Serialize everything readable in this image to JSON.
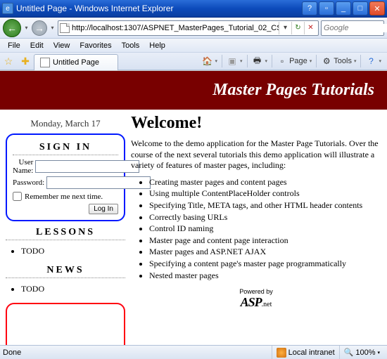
{
  "window": {
    "title": "Untitled Page - Windows Internet Explorer"
  },
  "address": {
    "url": "http://localhost:1307/ASPNET_MasterPages_Tutorial_02_CS/"
  },
  "search": {
    "placeholder": "Google"
  },
  "menu": {
    "file": "File",
    "edit": "Edit",
    "view": "View",
    "favorites": "Favorites",
    "tools": "Tools",
    "help": "Help"
  },
  "tab": {
    "title": "Untitled Page"
  },
  "toolbar": {
    "page": "Page",
    "tools": "Tools"
  },
  "banner": {
    "title": "Master Pages Tutorials"
  },
  "sidebar": {
    "date": "Monday, March 17",
    "signin": {
      "title": "SIGN IN",
      "user_label": "User Name:",
      "user_value": "",
      "pw_label": "Password:",
      "pw_value": "",
      "remember": "Remember me next time.",
      "login": "Log In"
    },
    "lessons": {
      "title": "LESSONS",
      "items": [
        "TODO"
      ]
    },
    "news": {
      "title": "NEWS",
      "items": [
        "TODO"
      ]
    }
  },
  "content": {
    "heading": "Welcome!",
    "intro": "Welcome to the demo application for the Master Page Tutorials. Over the course of the next several tutorials this demo application will illustrate a variety of features of master pages, including:",
    "bullets": [
      "Creating master pages and content pages",
      "Using multiple ContentPlaceHolder controls",
      "Specifying Title, META tags, and other HTML header contents",
      "Correctly basing URLs",
      "Control ID naming",
      "Master page and content page interaction",
      "Master pages and ASP.NET AJAX",
      "Specifying a content page's master page programmatically",
      "Nested master pages"
    ],
    "powered": "Powered by"
  },
  "status": {
    "done": "Done",
    "zone": "Local intranet",
    "zoom": "100%"
  }
}
